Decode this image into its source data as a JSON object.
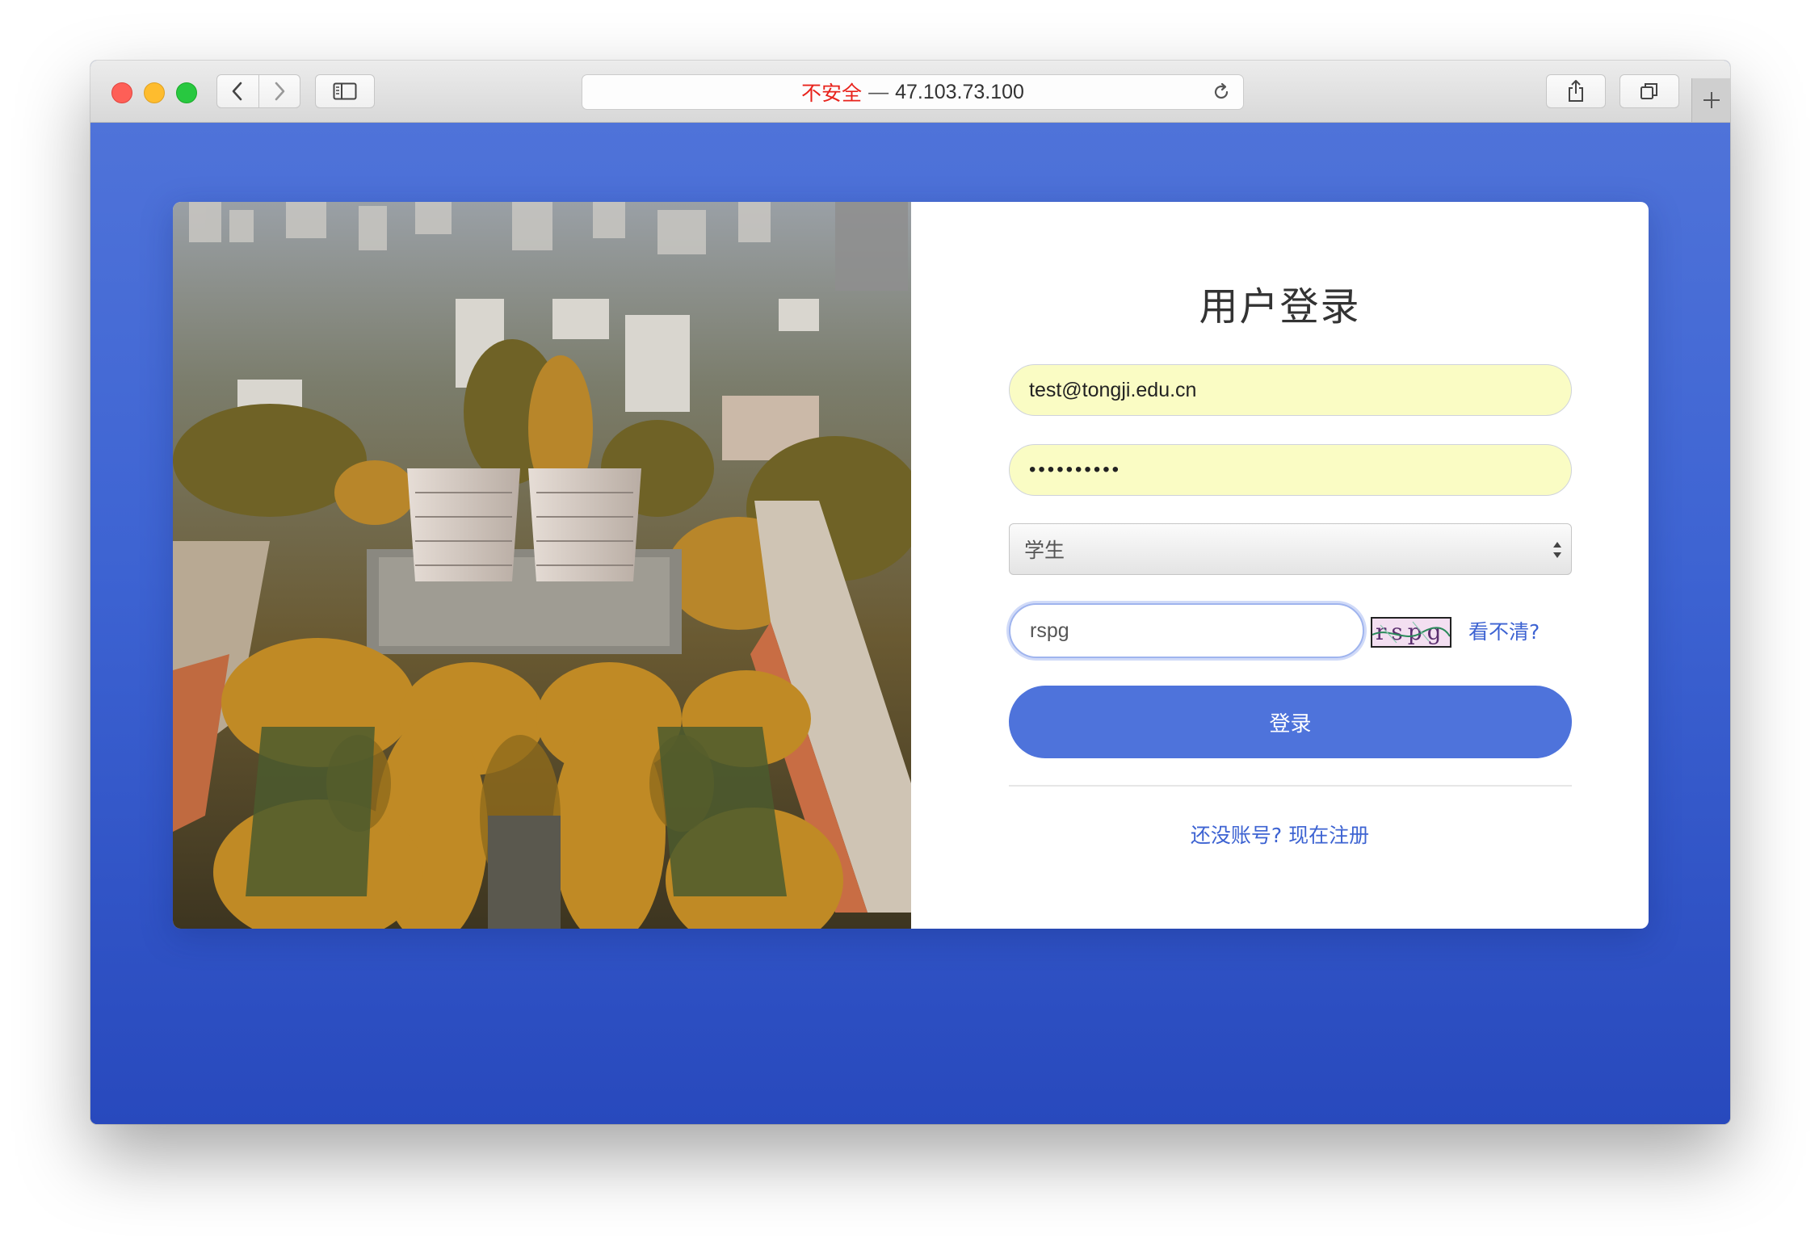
{
  "browser": {
    "url_security_label": "不安全",
    "url_separator": "—",
    "url_host": "47.103.73.100",
    "icons": {
      "back": "chevron-left-icon",
      "forward": "chevron-right-icon",
      "sidebar": "sidebar-icon",
      "reload": "reload-icon",
      "share": "share-icon",
      "tabs": "tabs-overview-icon",
      "new_tab": "plus-icon"
    }
  },
  "login": {
    "title": "用户登录",
    "email_value": "test@tongji.edu.cn",
    "password_mask": "••••••••••",
    "role_selected": "学生",
    "captcha_value": "rspg",
    "captcha_image_text": "rspg",
    "refresh_captcha_label": "看不清?",
    "submit_label": "登录",
    "register_link_label": "还没账号? 现在注册"
  },
  "colors": {
    "page_background_top": "#4f73d9",
    "page_background_bottom": "#2849bd",
    "button": "#4e73db",
    "link": "#3d63d2",
    "autofill": "#fafcc4",
    "insecure": "#e8231c"
  }
}
